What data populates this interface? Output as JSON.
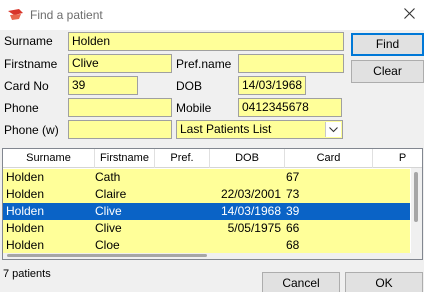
{
  "window": {
    "title": "Find a patient",
    "close_label": "✕"
  },
  "form": {
    "surname": {
      "label": "Surname",
      "value": "Holden"
    },
    "firstname": {
      "label": "Firstname",
      "value": "Clive"
    },
    "pref_name": {
      "label": "Pref.name",
      "value": ""
    },
    "card_no": {
      "label": "Card No",
      "value": "39"
    },
    "dob": {
      "label": "DOB",
      "value": "14/03/1968"
    },
    "phone": {
      "label": "Phone",
      "value": ""
    },
    "mobile": {
      "label": "Mobile",
      "value": "0412345678"
    },
    "phone_w": {
      "label": "Phone (w)",
      "value": ""
    },
    "list_select": {
      "value": "Last Patients List"
    }
  },
  "buttons": {
    "find": "Find",
    "clear": "Clear",
    "cancel": "Cancel",
    "ok": "OK"
  },
  "grid": {
    "columns": [
      "Surname",
      "Firstname",
      "Pref.",
      "DOB",
      "Card",
      "P"
    ],
    "rows": [
      {
        "surname": "Holden",
        "firstname": "Cath",
        "pref": "",
        "dob": "",
        "card": "67",
        "selected": false
      },
      {
        "surname": "Holden",
        "firstname": "Claire",
        "pref": "",
        "dob": "22/03/2001",
        "card": "73",
        "selected": false
      },
      {
        "surname": "Holden",
        "firstname": "Clive",
        "pref": "",
        "dob": "14/03/1968",
        "card": "39",
        "selected": true
      },
      {
        "surname": "Holden",
        "firstname": "Clive",
        "pref": "",
        "dob": "5/05/1975",
        "card": "66",
        "selected": false
      },
      {
        "surname": "Holden",
        "firstname": "Cloe",
        "pref": "",
        "dob": "",
        "card": "68",
        "selected": false
      }
    ]
  },
  "status": {
    "text": "7 patients"
  },
  "colors": {
    "field_bg": "#ffff99",
    "selected_row": "#0a63c6",
    "accent": "#0078d7"
  }
}
